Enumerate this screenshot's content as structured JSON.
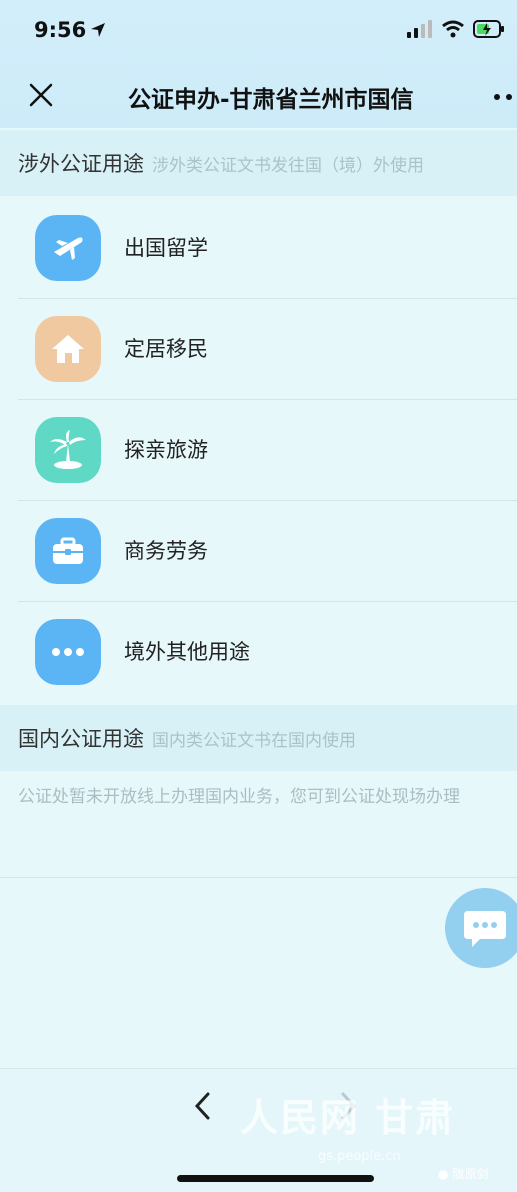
{
  "status_bar": {
    "time": "9:56"
  },
  "nav": {
    "title": "公证申办-甘肃省兰州市国信"
  },
  "foreign_section": {
    "title": "涉外公证用途",
    "subtitle": "涉外类公证文书发往国（境）外使用",
    "items": [
      {
        "label": "出国留学",
        "icon": "airplane-icon",
        "color": "#5bb5f4"
      },
      {
        "label": "定居移民",
        "icon": "house-icon",
        "color": "#f0c9a0"
      },
      {
        "label": "探亲旅游",
        "icon": "palm-tree-icon",
        "color": "#5fd9c6"
      },
      {
        "label": "商务劳务",
        "icon": "briefcase-icon",
        "color": "#5bb5f4"
      },
      {
        "label": "境外其他用途",
        "icon": "more-dots-icon",
        "color": "#5bb5f4"
      }
    ]
  },
  "domestic_section": {
    "title": "国内公证用途",
    "subtitle": "国内类公证文书在国内使用",
    "notice": "公证处暂未开放线上办理国内业务，您可到公证处现场办理"
  },
  "watermark": {
    "text": "人民网 甘肃",
    "url": "gs.people.cn",
    "tag": "陇原剑"
  }
}
